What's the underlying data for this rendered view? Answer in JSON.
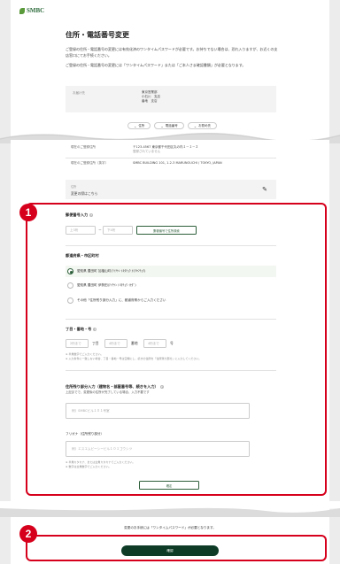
{
  "header": {
    "logo_text": "SMBC"
  },
  "page_title": "住所・電話番号変更",
  "intro": {
    "p1": "ご登録の住所・電話番号の変更には有効化済のワンタイムパスワードが必要です。お持ちでない場合は、恐れ入りますが、お近くの支店窓口にてお手続ください。",
    "p2": "ご登録の住所・電話番号の変更には「ワンタイムパスワード」または「ご本人さま確認書類」が必要となります。"
  },
  "current_address": {
    "label": "お届け先",
    "lines": [
      "東京営業部",
      "小石川　支店",
      "番地　支店"
    ]
  },
  "anchor_pills": [
    {
      "label": "住所",
      "icon": "chevron-down-icon"
    },
    {
      "label": "電話番号",
      "icon": "chevron-down-icon"
    },
    {
      "label": "お勤め先",
      "icon": "chevron-down-icon"
    }
  ],
  "detail_rows": [
    {
      "key": "現在のご登録住所",
      "value": "〒123-4567 東京都千代田区丸の内１－１－２",
      "note": "登録されていません"
    },
    {
      "key": "現在のご登録住所（英字）",
      "value": "SMBC BUILDING 101, 1-2-3 MARUNOUCHI / TOKYO, JAPAN",
      "note": ""
    }
  ],
  "notice_box": {
    "small": "住所",
    "text": "変更の際はこちら",
    "icon": "pencil-icon"
  },
  "badges": {
    "one": "1",
    "two": "2"
  },
  "postal": {
    "label": "郵便番号入力",
    "help_icon": "question-icon",
    "part1_placeholder": "上3桁",
    "separator": "－",
    "part2_placeholder": "下4桁",
    "search_button": "郵便番号で住所検索"
  },
  "prefecture": {
    "label": "都道府県・市区町村",
    "options": [
      {
        "label": "愛知県 豊田町 加福山町(ｱｲﾁｹﾝ ﾄﾖﾀﾁｮｳ ｶﾌｸﾔﾏﾁｮｳ)",
        "selected": true
      },
      {
        "label": "愛知県 豊田町 伊勢田(ｱｲﾁｹﾝ ﾄﾖﾀﾁｮｳ ｲｾﾀﾞ)",
        "selected": false
      },
      {
        "label": "その他「住所残り部分入力」に、都道府県からご入力ください",
        "selected": false
      }
    ]
  },
  "chome": {
    "label": "丁目・番地・号",
    "fields": [
      {
        "placeholder": "2桁まで",
        "suffix": "丁目"
      },
      {
        "placeholder": "4桁まで",
        "suffix": "番地"
      },
      {
        "placeholder": "4桁まで",
        "suffix": "号"
      }
    ],
    "notes": [
      "※ 半角数字でご入力ください。",
      "※ 入力条件に一致しない場合、丁目・番地・号は空欄にし、続きの住所を「住所残り部分」に入力してください。"
    ]
  },
  "remaining": {
    "label": "住所残り部分入力（建物名・部屋番号等、続きを入力）",
    "help": "上記までで、変更後の住所が完了している場合、入力不要です",
    "placeholder": "例）SMBCビル１０１号室"
  },
  "furigana": {
    "label": "フリガナ（住所残り部分）",
    "placeholder": "例）エスエムビーシービル１０１ゴウシツ",
    "notes": [
      "※ 半角カタカナ、または全角カタカナでご入力ください。",
      "※ 数字は全角数字でご入力ください。"
    ]
  },
  "confirm_small_button": "確定",
  "footer": {
    "note": "変更のお手続には「ワンタイムパスワード」が必要となります。",
    "primary_button": "確認"
  },
  "colors": {
    "accent_red": "#d6001c",
    "brand_green": "#0d3b26"
  }
}
